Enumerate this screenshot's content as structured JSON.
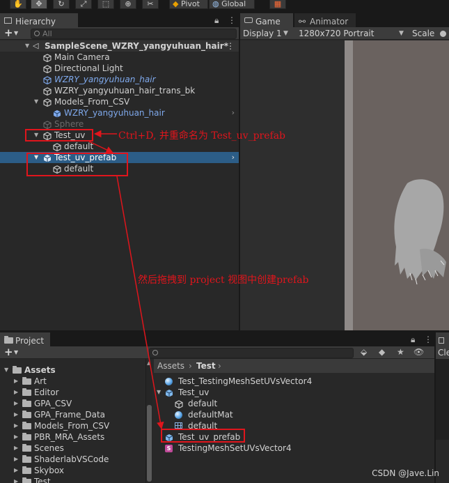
{
  "toolbar": {
    "pivot_label": "Pivot",
    "global_label": "Global",
    "tools": [
      "hand-tool-icon",
      "move-tool-icon",
      "rotate-tool-icon",
      "scale-tool-icon",
      "rect-tool-icon",
      "transform-tool-icon",
      "custom-tool-icon"
    ]
  },
  "hierarchy": {
    "tab_label": "Hierarchy",
    "search_placeholder": "All",
    "scene_name": "SampleScene_WZRY_yangyuhuan_hair*",
    "items": [
      {
        "label": "Main Camera",
        "kind": "object"
      },
      {
        "label": "Directional Light",
        "kind": "object"
      },
      {
        "label": "WZRY_yangyuhuan_hair",
        "kind": "prefab-missing"
      },
      {
        "label": "WZRY_yangyuhuan_hair_trans_bk",
        "kind": "object"
      },
      {
        "label": "Models_From_CSV",
        "kind": "object"
      },
      {
        "label": "WZRY_yangyuhuan_hair",
        "kind": "prefab"
      },
      {
        "label": "Sphere",
        "kind": "disabled"
      },
      {
        "label": "Test_uv",
        "kind": "object"
      },
      {
        "label": "default",
        "kind": "object"
      },
      {
        "label": "Test_uv_prefab",
        "kind": "selected"
      },
      {
        "label": "default",
        "kind": "object"
      }
    ]
  },
  "game": {
    "tab_game": "Game",
    "tab_animator": "Animator",
    "display_label": "Display 1",
    "resolution_label": "1280x720 Portrait",
    "scale_label": "Scale"
  },
  "project": {
    "tab_label": "Project",
    "side_tab_label": "Cle",
    "breadcrumb": [
      "Assets",
      "Test"
    ],
    "tree": [
      {
        "label": "Assets",
        "level": 0
      },
      {
        "label": "Art",
        "level": 1
      },
      {
        "label": "Editor",
        "level": 1
      },
      {
        "label": "GPA_CSV",
        "level": 1
      },
      {
        "label": "GPA_Frame_Data",
        "level": 1
      },
      {
        "label": "Models_From_CSV",
        "level": 1
      },
      {
        "label": "PBR_MRA_Assets",
        "level": 1
      },
      {
        "label": "Scenes",
        "level": 1
      },
      {
        "label": "ShaderlabVSCode",
        "level": 1
      },
      {
        "label": "Skybox",
        "level": 1
      },
      {
        "label": "Test",
        "level": 1
      }
    ],
    "assets": [
      {
        "label": "Test_TestingMeshSetUVsVector4",
        "icon": "material"
      },
      {
        "label": "Test_uv",
        "icon": "prefab"
      },
      {
        "label": "default",
        "icon": "mesh"
      },
      {
        "label": "defaultMat",
        "icon": "material"
      },
      {
        "label": "default",
        "icon": "grid"
      },
      {
        "label": "Test_uv_prefab",
        "icon": "prefab"
      },
      {
        "label": "TestingMeshSetUVsVector4",
        "icon": "script"
      }
    ]
  },
  "annotations": {
    "ctrl_d": "Ctrl+D, 并重命名为 Test_uv_prefab",
    "drag": "然后拖拽到 project 视图中创建prefab"
  },
  "watermark": "CSDN @Jave.Lin",
  "colors": {
    "selection": "#2c5d87",
    "annotation_red": "#e0151c",
    "prefab_blue": "#7fa9ec",
    "panel_bg": "#282828",
    "toolbar_bg": "#191919"
  }
}
